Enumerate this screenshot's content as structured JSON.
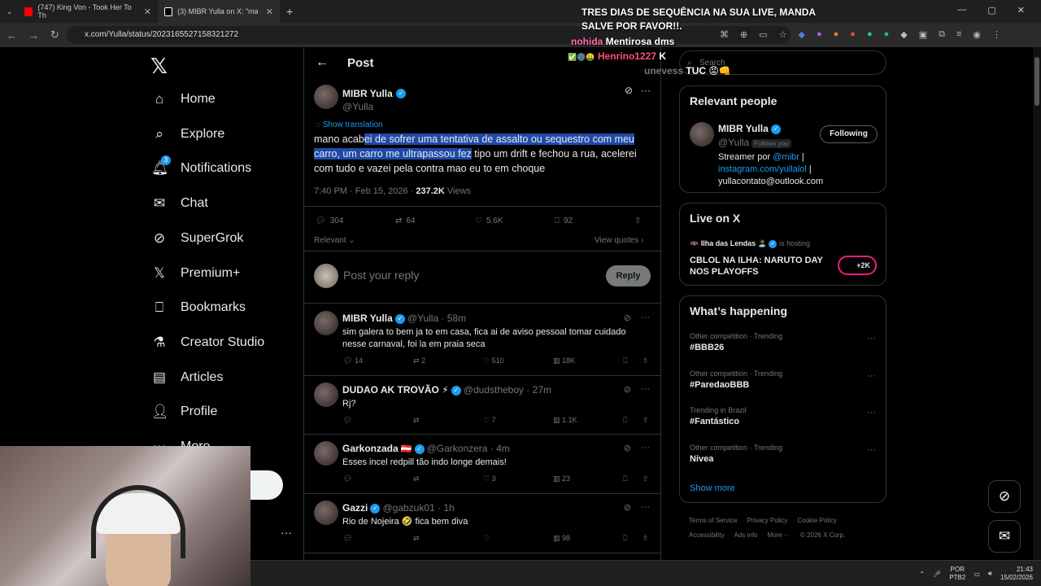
{
  "browser": {
    "tabs": [
      {
        "label": "(747) King Von - Took Her To Th",
        "color": "#ff0000"
      },
      {
        "label": "(3) MIBR Yulla on X: \"mano acab",
        "color": "#ffffff"
      }
    ],
    "url": "x.com/Yulla/status/2023165527158321272"
  },
  "overlay": [
    {
      "name": "",
      "text": "TRES DIAS DE SEQUÊNCIA NA SUA LIVE, MANDA",
      "line": 1
    },
    {
      "name": "",
      "text": "SALVE POR FAVOR!!.",
      "line": 2
    },
    {
      "name": "nohida",
      "text": "Mentirosa dms",
      "line": 3
    },
    {
      "name": "Henrino1227",
      "text": "K",
      "line": 4
    },
    {
      "name": "unevess",
      "text": "TUC",
      "line": 5
    }
  ],
  "nav": {
    "items": [
      {
        "label": "Home",
        "icon": "home-icon"
      },
      {
        "label": "Explore",
        "icon": "search-icon"
      },
      {
        "label": "Notifications",
        "icon": "bell-icon",
        "badge": "3"
      },
      {
        "label": "Chat",
        "icon": "mail-icon"
      },
      {
        "label": "SuperGrok",
        "icon": "grok-icon"
      },
      {
        "label": "Premium+",
        "icon": "x-logo-icon"
      },
      {
        "label": "Bookmarks",
        "icon": "bookmark-icon"
      },
      {
        "label": "Creator Studio",
        "icon": "flask-icon"
      },
      {
        "label": "Articles",
        "icon": "article-icon"
      },
      {
        "label": "Profile",
        "icon": "person-icon"
      },
      {
        "label": "More",
        "icon": "more-icon"
      }
    ]
  },
  "post": {
    "header": "Post",
    "author": {
      "name": "MIBR Yulla",
      "handle": "@Yulla"
    },
    "show_translation": "Show translation",
    "text_pre": "mano acab",
    "text_highlight": "ei de sofrer uma tentativa de assalto ou sequestro com meu carro, um carro me ultrapassou fez",
    "text_post": " tipo um drift e fechou a rua, acelerei com tudo e vazei pela contra mao eu to em choque",
    "time": "7:40 PM · Feb 15, 2026 · ",
    "views_count": "237.2K",
    "views_label": " Views",
    "stats": {
      "replies": "304",
      "reposts": "64",
      "likes": "5.6K",
      "bookmarks": "92"
    },
    "relevant": "Relevant",
    "view_quotes": "View quotes",
    "reply_placeholder": "Post your reply",
    "reply_button": "Reply"
  },
  "replies": [
    {
      "name": "MIBR Yulla",
      "handle": "@Yulla · 58m",
      "flag": "",
      "text": "sim galera to bem ja to em casa, fica ai de aviso pessoal tomar cuidado nesse carnaval, foi la em praia seca",
      "replies": "14",
      "reposts": "2",
      "likes": "510",
      "views": "18K"
    },
    {
      "name": "DUDAO AK TROVÃO ⚡",
      "handle": "@dudstheboy · 27m",
      "flag": "",
      "text": "Rj?",
      "replies": "",
      "reposts": "",
      "likes": "7",
      "views": "1.1K"
    },
    {
      "name": "Garkonzada",
      "handle": "@Garkonzera · 4m",
      "flag": "🇦🇹",
      "text": "Esses incel redpill tão indo longe demais!",
      "replies": "",
      "reposts": "",
      "likes": "3",
      "views": "23"
    },
    {
      "name": "Gazzi",
      "handle": "@gabzuk01 · 1h",
      "flag": "",
      "text": "Rio de Nojeira 🤣 fica bem diva",
      "replies": "",
      "reposts": "",
      "likes": "",
      "views": "98"
    }
  ],
  "sidebar": {
    "search_placeholder": "Search",
    "relevant_title": "Relevant people",
    "person": {
      "name": "MIBR Yulla",
      "handle": "@Yulla",
      "follows_you": "Follows you",
      "follow_btn": "Following",
      "bio_pre": "Streamer por ",
      "bio_link1": "@mibr",
      "bio_sep": " |",
      "bio_link2": "instagram.com/yullalol",
      "bio_sep2": " |",
      "bio_email": "yullacontato@outlook.com"
    },
    "live_title": "Live on X",
    "live_host": "Ilha das Lendas 🏝️",
    "live_hosting": "is hosting",
    "live_name": "CBLOL NA ILHA: NARUTO DAY NOS PLAYOFFS",
    "live_count": "+2K",
    "happening_title": "What’s happening",
    "trends": [
      {
        "cat": "Other competition · Trending",
        "name": "#BBB26"
      },
      {
        "cat": "Other competition · Trending",
        "name": "#ParedaoBBB"
      },
      {
        "cat": "Trending in Brazil",
        "name": "#Fantástico"
      },
      {
        "cat": "Other competition · Trending",
        "name": "Nivea"
      }
    ],
    "show_more": "Show more",
    "footer": [
      "Terms of Service",
      "Privacy Policy",
      "Cookie Policy",
      "Accessibility",
      "Ads info",
      "More ···",
      "© 2026 X Corp."
    ]
  },
  "taskbar": {
    "lang1": "POR",
    "lang2": "PTB2",
    "time": "21:43",
    "date": "15/02/2026"
  }
}
